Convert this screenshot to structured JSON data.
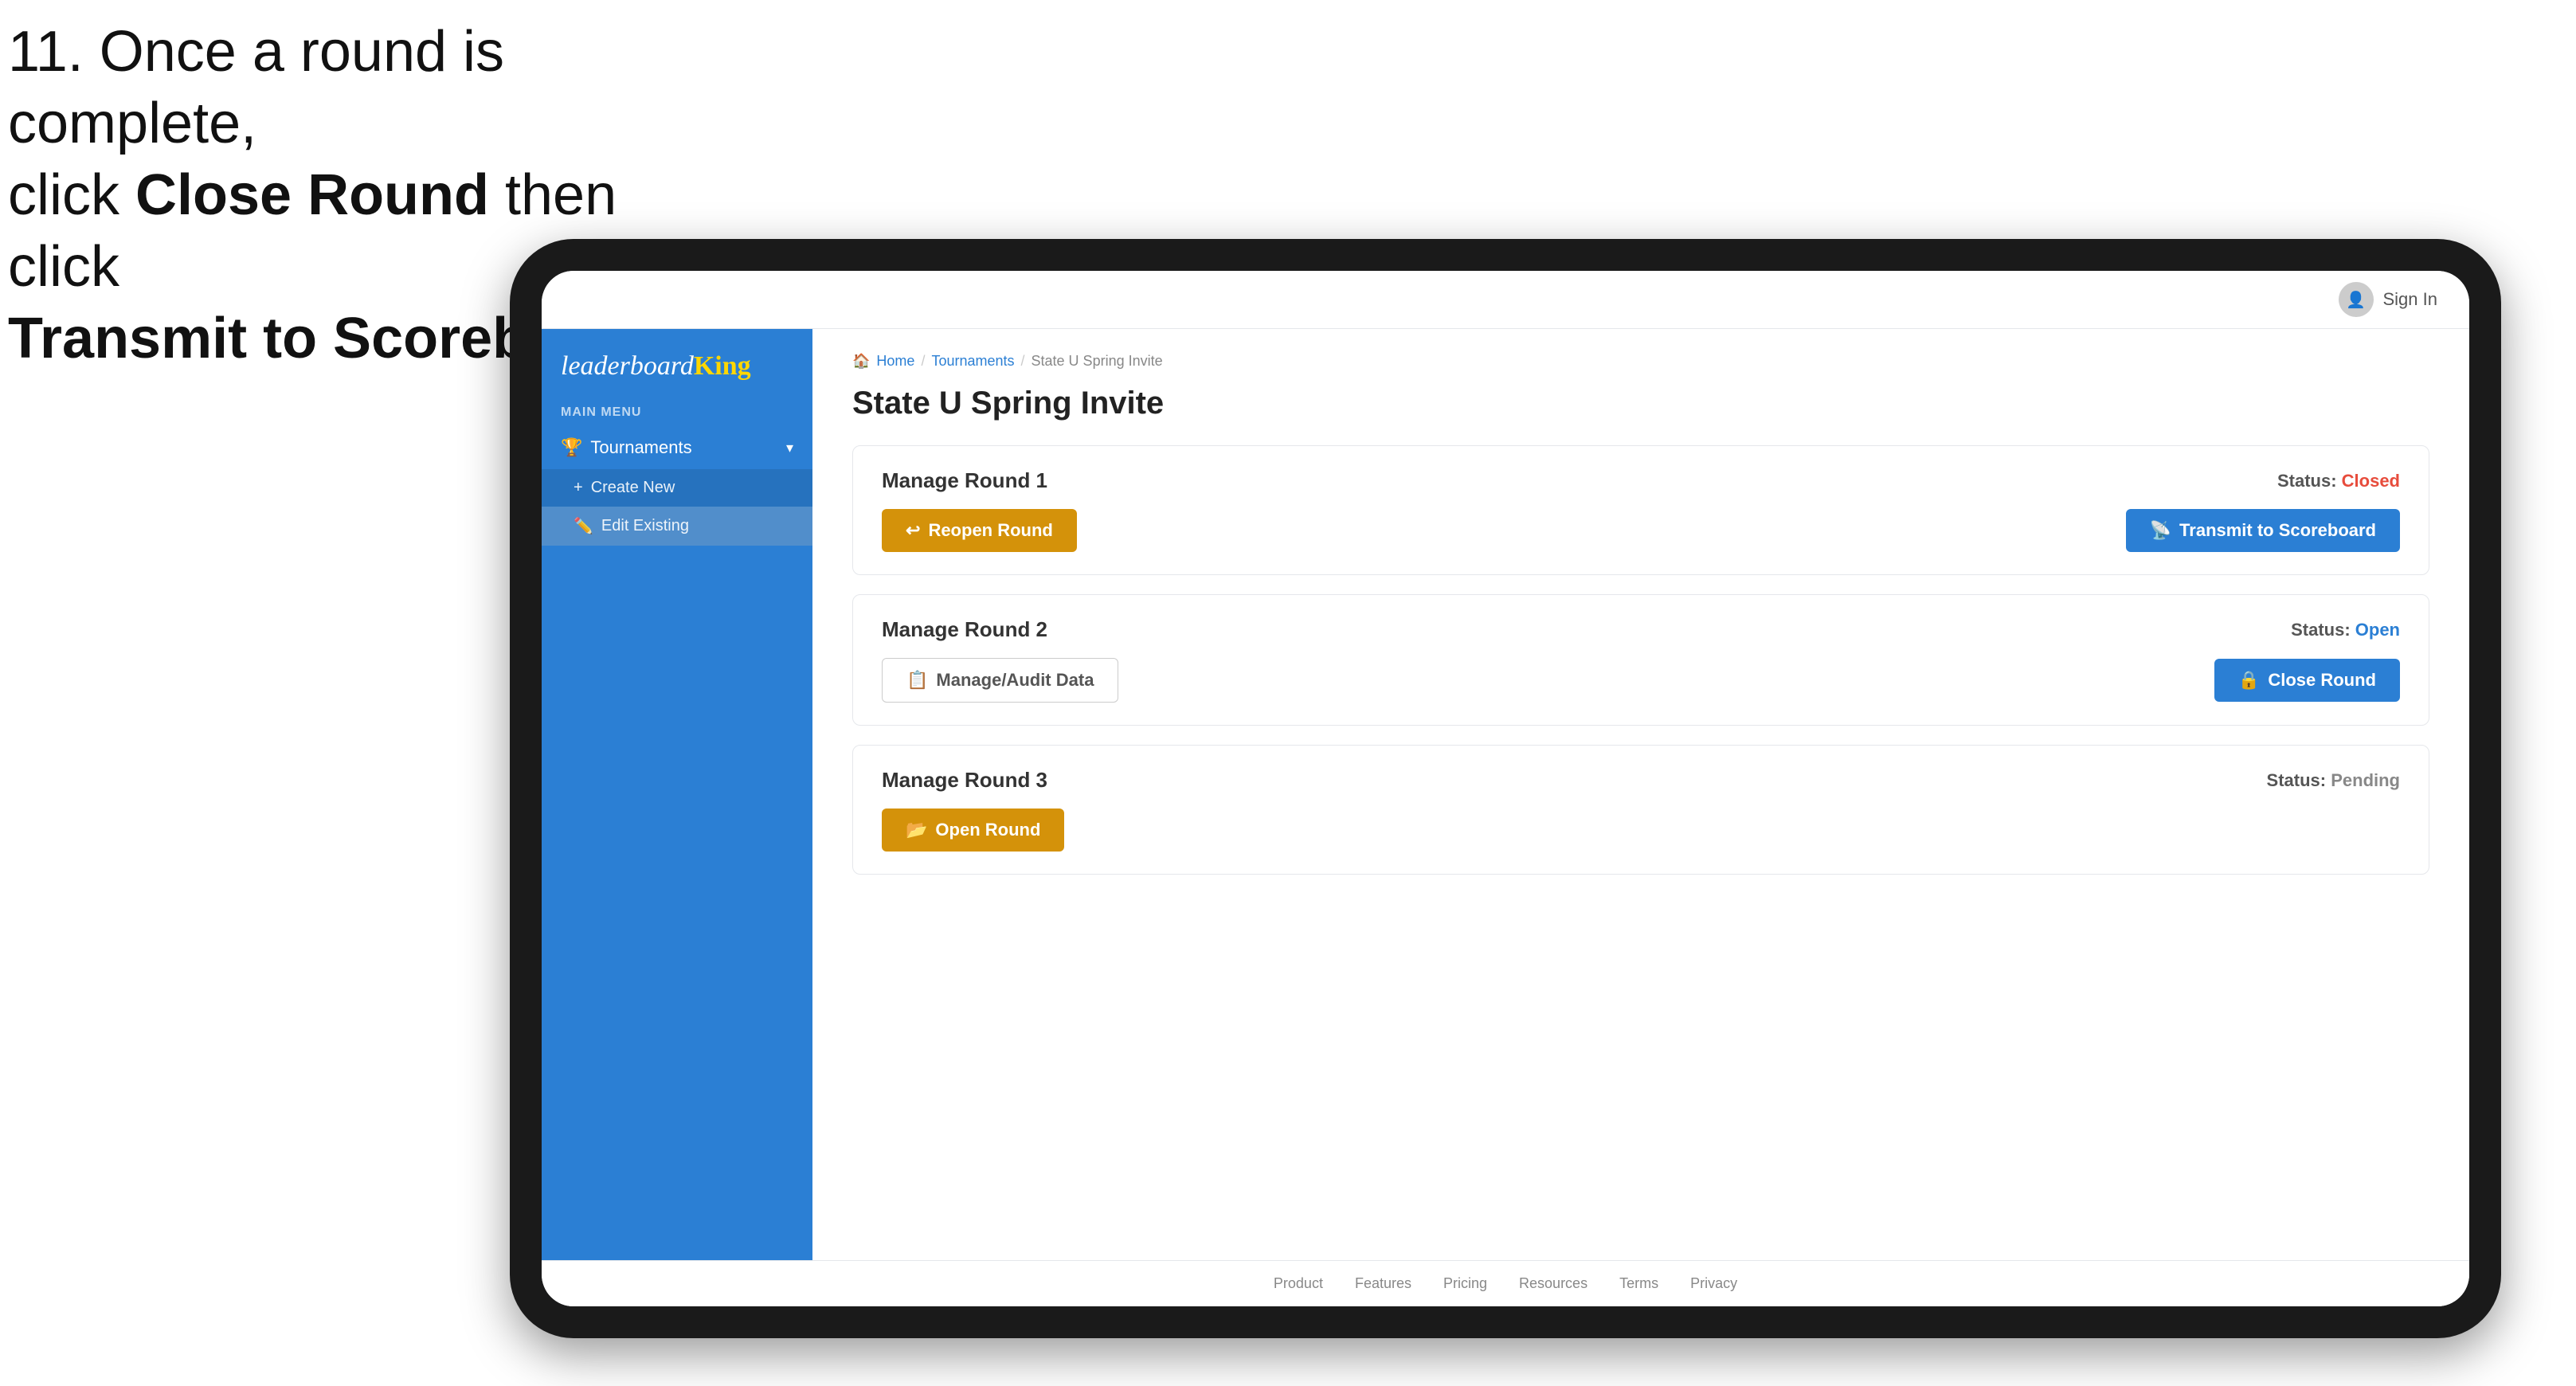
{
  "instruction": {
    "line1": "11. Once a round is complete,",
    "line2": "click ",
    "bold1": "Close Round",
    "line3": " then click",
    "line4": "",
    "bold2": "Transmit to Scoreboard."
  },
  "header": {
    "sign_in_label": "Sign In"
  },
  "sidebar": {
    "logo": "leaderboard",
    "logo_king": "King",
    "main_menu_label": "MAIN MENU",
    "nav_items": [
      {
        "label": "Tournaments",
        "icon": "🏆",
        "expanded": true
      }
    ],
    "sub_items": [
      {
        "label": "Create New",
        "icon": "+"
      },
      {
        "label": "Edit Existing",
        "icon": "✏️",
        "active": true
      }
    ]
  },
  "breadcrumb": {
    "home": "Home",
    "tournaments": "Tournaments",
    "current": "State U Spring Invite"
  },
  "page": {
    "title": "State U Spring Invite"
  },
  "rounds": [
    {
      "id": "round1",
      "title": "Manage Round 1",
      "status_label": "Status:",
      "status_value": "Closed",
      "status_class": "status-closed",
      "buttons": [
        {
          "label": "Reopen Round",
          "style": "btn-gold",
          "icon": "↩"
        },
        {
          "label": "Transmit to Scoreboard",
          "style": "btn-blue",
          "icon": "📡"
        }
      ]
    },
    {
      "id": "round2",
      "title": "Manage Round 2",
      "status_label": "Status:",
      "status_value": "Open",
      "status_class": "status-open",
      "buttons": [
        {
          "label": "Manage/Audit Data",
          "style": "btn-outline",
          "icon": "📋"
        },
        {
          "label": "Close Round",
          "style": "btn-blue",
          "icon": "🔒"
        }
      ]
    },
    {
      "id": "round3",
      "title": "Manage Round 3",
      "status_label": "Status:",
      "status_value": "Pending",
      "status_class": "status-pending",
      "buttons": [
        {
          "label": "Open Round",
          "style": "btn-gold",
          "icon": "📂"
        }
      ]
    }
  ],
  "footer": {
    "links": [
      "Product",
      "Features",
      "Pricing",
      "Resources",
      "Terms",
      "Privacy"
    ]
  }
}
